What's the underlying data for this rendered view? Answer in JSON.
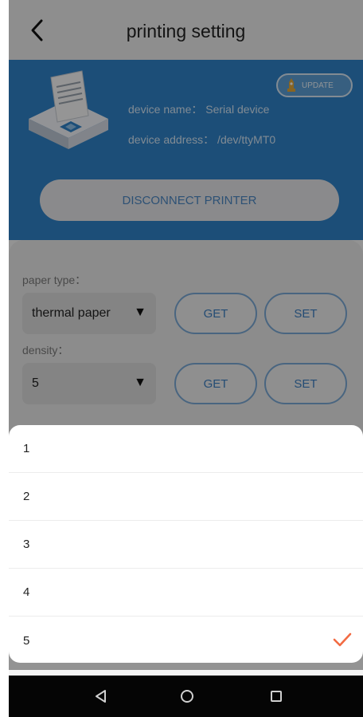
{
  "header": {
    "title": "printing setting",
    "back_icon": "chevron-left-icon"
  },
  "device": {
    "update_label": "UPDATE",
    "name_line": "device name： Serial device",
    "address_line": "device address： /dev/ttyMT0",
    "disconnect_label": "DISCONNECT PRINTER"
  },
  "settings": {
    "paper_type_label": "paper type：",
    "paper_type_value": "thermal paper",
    "density_label": "density：",
    "density_value": "5",
    "get_label": "GET",
    "set_label": "SET",
    "dropdown_arrow": "▼"
  },
  "picker": {
    "options": [
      "1",
      "2",
      "3",
      "4",
      "5"
    ],
    "selected": "5",
    "check_color": "#f26b43"
  },
  "colors": {
    "primary": "#2f83c9",
    "accent": "#f26b43"
  }
}
